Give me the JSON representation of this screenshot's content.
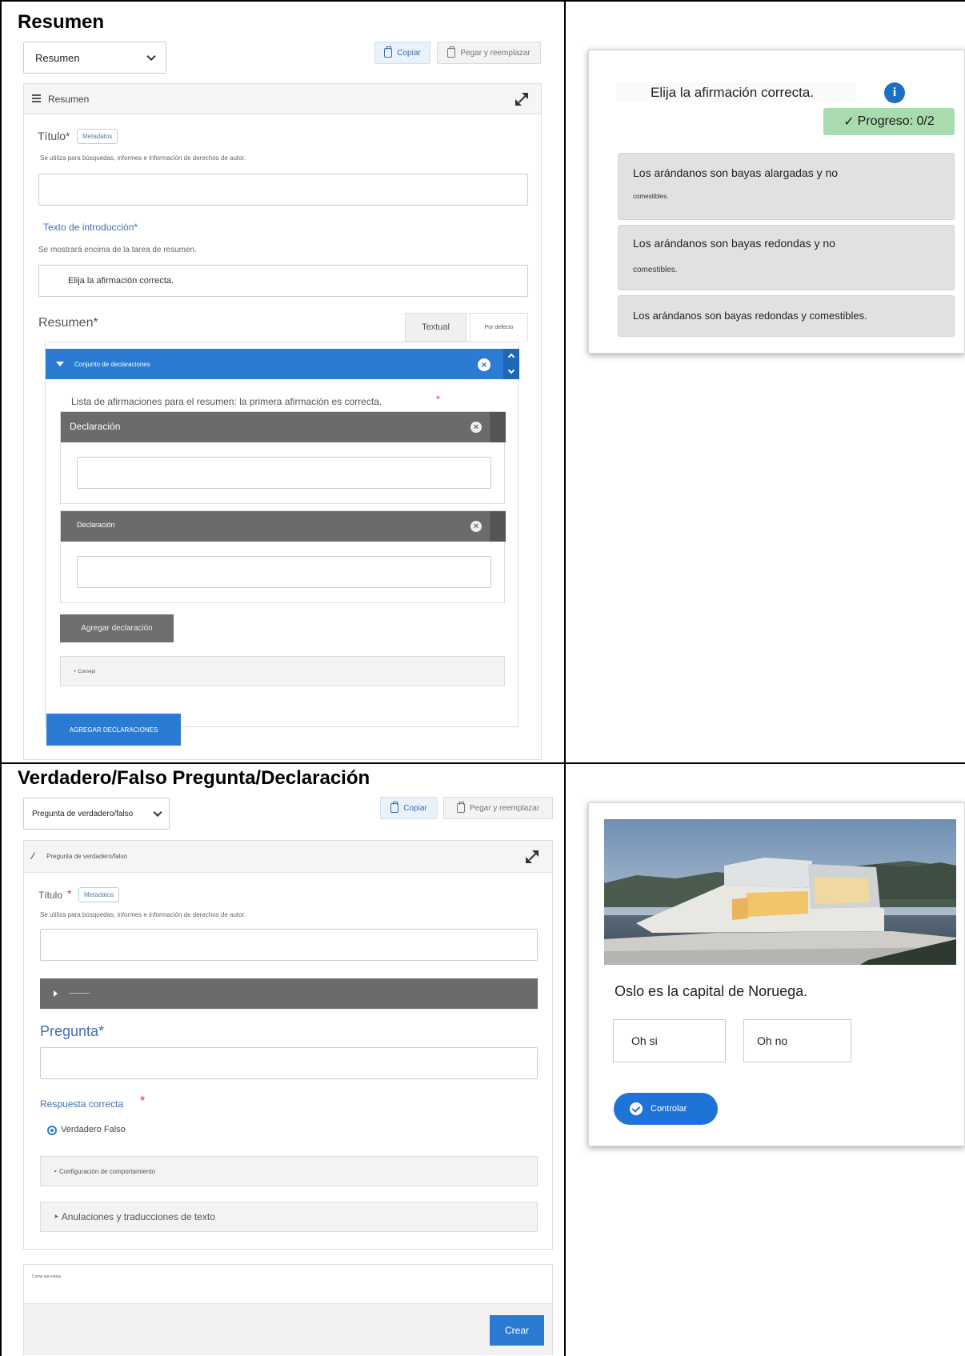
{
  "section1": {
    "title": "Resumen",
    "editor": {
      "content_type_select": "Resumen",
      "copy_button": "Copiar",
      "paste_button": "Pegar y reemplazar",
      "panel_title": "Resumen",
      "title_label": "Título*",
      "metadata_badge": "Metadatos",
      "title_help": "Se utiliza para búsquedas, informes e información de derechos de autor.",
      "intro_label": "Texto de introducción*",
      "intro_help": "Se mostrará encima de la tarea de resumen.",
      "intro_value": "Elija la afirmación correcta.",
      "summary_label": "Resumen*",
      "tab_textual": "Textual",
      "tab_default": "Por defecto",
      "statement_set_label": "Conjunto de declaraciones",
      "statements_list_label": "Lista de afirmaciones para el resumen: la primera afirmación es correcta.",
      "statement_1_label": "Declaración",
      "statement_2_label": "Declaración",
      "add_statement_button": "Agregar declaración",
      "tip_label": "Consejo",
      "add_statements_button": "AGREGAR DECLARACIONES"
    },
    "preview": {
      "instruction": "Elija la afirmación correcta.",
      "progress": "Progreso: 0/2",
      "options": [
        {
          "line1": "Los arándanos son bayas alargadas y no",
          "line2": "comestibles."
        },
        {
          "line1": "Los arándanos son bayas redondas y no",
          "line2": "comestibles."
        },
        {
          "line1": "Los arándanos son bayas redondas y comestibles.",
          "line2": ""
        }
      ]
    }
  },
  "section2": {
    "title": "Verdadero/Falso Pregunta/Declaración",
    "editor": {
      "content_type_select": "Pregunta de verdadero/falso",
      "copy_button": "Copiar",
      "paste_button": "Pegar y reemplazar",
      "panel_title": "Pregunta de verdadero/falso",
      "title_label": "Título",
      "metadata_badge": "Metadatos",
      "title_help": "Se utiliza para búsquedas, informes e información de derechos de autor.",
      "question_label": "Pregunta*",
      "correct_answer_label": "Respuesta correcta",
      "radio_options": "Verdadero Falso",
      "behaviour_settings": "Configuración de comportamiento",
      "overrides": "Anulaciones y traducciones de texto",
      "footer_small": "Comp ala estela",
      "create_button": "Crear"
    },
    "preview": {
      "question": "Oslo es la capital de Noruega.",
      "true_label": "Oh si",
      "false_label": "Oh no",
      "check_button": "Controlar"
    }
  },
  "colors": {
    "accent_blue": "#2a7bd1",
    "progress_green": "#a8dcae",
    "dark_bar": "#6b6b6b",
    "required_red": "#d9302e"
  }
}
